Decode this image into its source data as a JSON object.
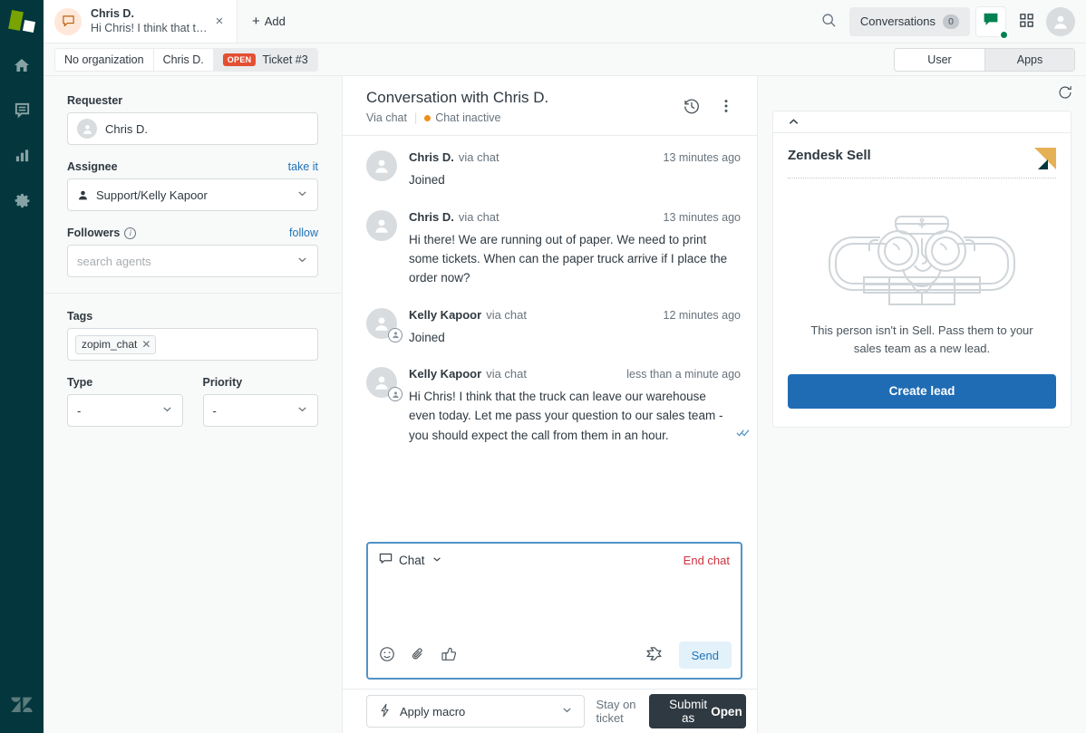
{
  "rail": {
    "logo_name": "zendesk-support-logo",
    "items": [
      {
        "name": "home",
        "icon": "home-icon"
      },
      {
        "name": "views",
        "icon": "views-icon"
      },
      {
        "name": "reporting",
        "icon": "reporting-icon"
      },
      {
        "name": "admin",
        "icon": "gear-icon"
      }
    ],
    "bottom_logo": "zendesk-logo"
  },
  "topbar": {
    "tab": {
      "title": "Chris D.",
      "subtitle": "Hi Chris! I think that th...",
      "icon": "chat-bubble-icon",
      "close_label": "×"
    },
    "add_label": "Add",
    "add_plus": "+",
    "search_icon": "search-icon",
    "conversations_label": "Conversations",
    "conversations_count": "0",
    "chat_status_icon": "chat-bubble-icon",
    "apps_grid_icon": "grid-icon",
    "user_avatar": "avatar"
  },
  "subbar": {
    "breadcrumbs": [
      {
        "label": "No organization",
        "badge": null
      },
      {
        "label": "Chris D.",
        "badge": null
      },
      {
        "label": "Ticket #3",
        "badge": "OPEN"
      }
    ],
    "toggle": [
      {
        "label": "User",
        "active": false
      },
      {
        "label": "Apps",
        "active": true
      }
    ]
  },
  "properties": {
    "requester": {
      "label": "Requester",
      "value": "Chris D."
    },
    "assignee": {
      "label": "Assignee",
      "action_label": "take it",
      "value": "Support/Kelly Kapoor"
    },
    "followers": {
      "label": "Followers",
      "action_label": "follow",
      "placeholder": "search agents"
    },
    "tags": {
      "label": "Tags",
      "values": [
        "zopim_chat"
      ]
    },
    "type": {
      "label": "Type",
      "value": "-"
    },
    "priority": {
      "label": "Priority",
      "value": "-"
    }
  },
  "conversation": {
    "title": "Conversation with Chris D.",
    "via": "Via chat",
    "status": "Chat inactive",
    "history_icon": "history-icon",
    "more_icon": "more-vertical-icon",
    "messages": [
      {
        "author": "Chris D.",
        "via": "via chat",
        "time": "13 minutes ago",
        "text": "Joined",
        "is_agent": false,
        "read": false
      },
      {
        "author": "Chris D.",
        "via": "via chat",
        "time": "13 minutes ago",
        "text": "Hi there! We are running out of paper. We need to print some tickets. When can the paper truck arrive if I place the order now?",
        "is_agent": false,
        "read": false
      },
      {
        "author": "Kelly Kapoor",
        "via": "via chat",
        "time": "12 minutes ago",
        "text": "Joined",
        "is_agent": true,
        "read": false
      },
      {
        "author": "Kelly Kapoor",
        "via": "via chat",
        "time": "less than a minute ago",
        "text": "Hi Chris! I think that the truck can leave our warehouse even today. Let me pass your question to our sales team - you should expect the call from them in an hour.",
        "is_agent": true,
        "read": true
      }
    ]
  },
  "composer": {
    "channel_label": "Chat",
    "channel_icon": "chat-bubble-icon",
    "end_chat_label": "End chat",
    "body_value": "",
    "body_placeholder": "",
    "emoji_icon": "emoji-icon",
    "attach_icon": "paperclip-icon",
    "thumb_icon": "thumbs-up-icon",
    "shortcut_icon": "shortcut-icon",
    "send_label": "Send"
  },
  "footer": {
    "macro_label": "Apply macro",
    "macro_icon": "lightning-icon",
    "stay_label": "Stay on ticket",
    "submit_prefix": "Submit as",
    "submit_status": "Open"
  },
  "apps": {
    "refresh_icon": "refresh-icon",
    "collapse_icon": "chevron-up-icon",
    "title": "Zendesk Sell",
    "illustration": "sailor-binoculars-illustration",
    "message": "This person isn't in Sell. Pass them to your sales team as a new lead.",
    "cta_label": "Create lead"
  },
  "colors": {
    "rail_bg": "#03363d",
    "accent_blue": "#1f73b7",
    "open_badge": "#e34f32",
    "danger": "#cc3340",
    "status_orange": "#ed8f1c",
    "online_green": "#038153",
    "submit_dark": "#2f3941",
    "cta_blue": "#1f6cb5",
    "sell_gold": "#e5b155"
  }
}
